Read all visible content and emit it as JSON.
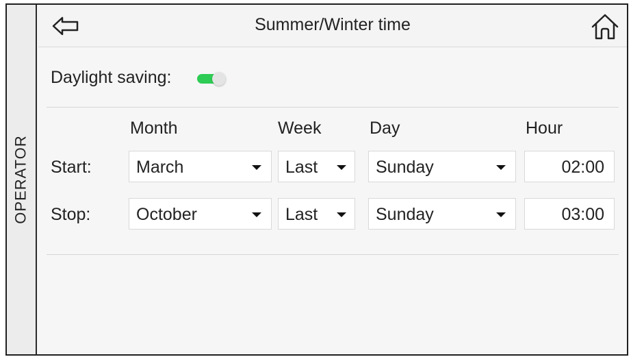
{
  "sidebar": {
    "label": "OPERATOR"
  },
  "header": {
    "title": "Summer/Winter time",
    "back_icon": "back-arrow-icon",
    "home_icon": "home-icon"
  },
  "daylight_saving": {
    "label": "Daylight saving:",
    "enabled": true,
    "on_color": "#2ecc55"
  },
  "columns": {
    "month": "Month",
    "week": "Week",
    "day": "Day",
    "hour": "Hour"
  },
  "start": {
    "label": "Start:",
    "month": "March",
    "week": "Last",
    "day": "Sunday",
    "hour": "02:00"
  },
  "stop": {
    "label": "Stop:",
    "month": "October",
    "week": "Last",
    "day": "Sunday",
    "hour": "03:00"
  }
}
